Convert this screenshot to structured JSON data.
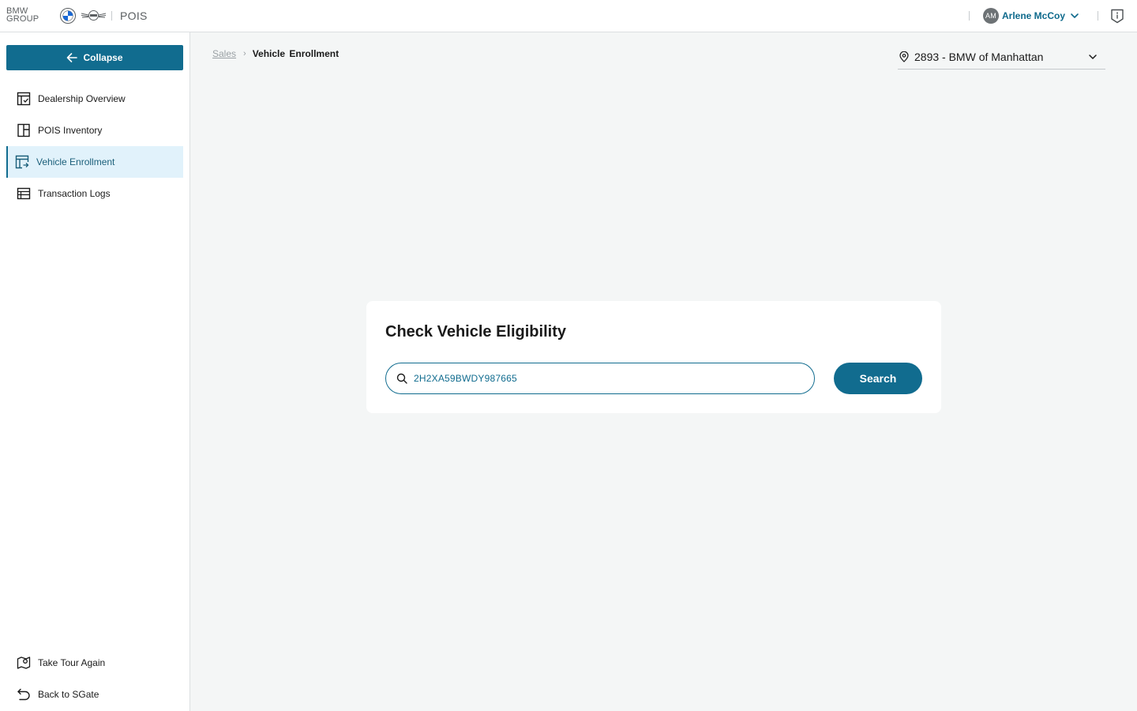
{
  "header": {
    "brand_line1": "BMW",
    "brand_line2": "GROUP",
    "roundel_icon": "bmw-roundel-icon",
    "mini_icon": "mini-logo-icon",
    "app_name": "POIS",
    "user": {
      "initials": "AM",
      "name": "Arlene McCoy",
      "chevron_icon": "chevron-down-icon"
    },
    "info_icon": "info-icon"
  },
  "sidebar": {
    "collapse_label": "Collapse",
    "collapse_icon": "arrow-left-icon",
    "items": [
      {
        "label": "Dealership Overview",
        "icon": "dashboard-icon",
        "active": false
      },
      {
        "label": "POIS Inventory",
        "icon": "inventory-icon",
        "active": false
      },
      {
        "label": "Vehicle Enrollment",
        "icon": "enrollment-icon",
        "active": true
      },
      {
        "label": "Transaction Logs",
        "icon": "logs-icon",
        "active": false
      }
    ],
    "bottom_items": [
      {
        "label": "Take Tour Again",
        "icon": "map-pin-icon"
      },
      {
        "label": "Back to SGate",
        "icon": "undo-icon"
      }
    ]
  },
  "breadcrumb": {
    "parent": "Sales",
    "current": "Vehicle Enrollment"
  },
  "dealer_select": {
    "value": "2893 - BMW of Manhattan",
    "icon": "location-pin-icon"
  },
  "eligibility_card": {
    "title": "Check Vehicle Eligibility",
    "search_value": "2H2XA59BWDY987665",
    "search_placeholder": "",
    "search_button_label": "Search"
  },
  "colors": {
    "accent": "#116c8f",
    "active_bg": "#e1f2fb",
    "page_bg": "#f4f6f6"
  }
}
